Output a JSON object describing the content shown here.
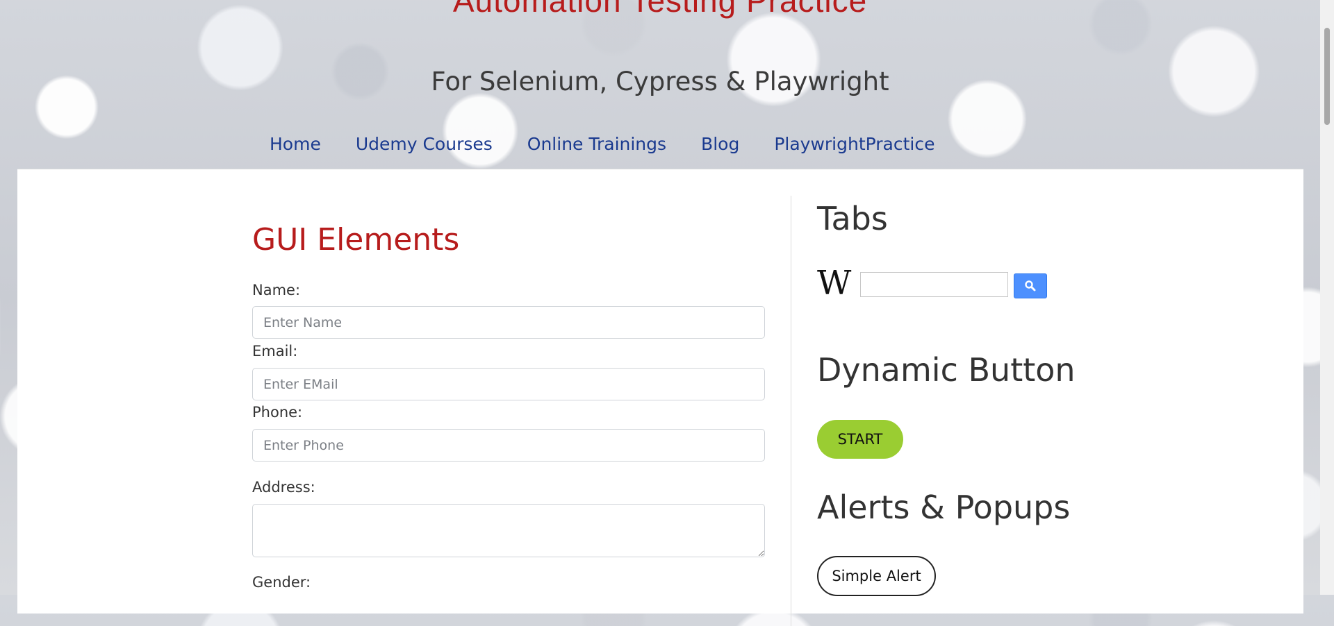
{
  "header": {
    "title": "Automation Testing Practice",
    "subtitle": "For Selenium, Cypress & Playwright",
    "nav": [
      "Home",
      "Udemy Courses",
      "Online Trainings",
      "Blog",
      "PlaywrightPractice"
    ]
  },
  "gui": {
    "title": "GUI Elements",
    "name_label": "Name:",
    "name_placeholder": "Enter Name",
    "email_label": "Email:",
    "email_placeholder": "Enter EMail",
    "phone_label": "Phone:",
    "phone_placeholder": "Enter Phone",
    "address_label": "Address:",
    "gender_label": "Gender:"
  },
  "sidebar": {
    "tabs_title": "Tabs",
    "wiki_logo": "W",
    "dynamic_title": "Dynamic Button",
    "start_label": "START",
    "alerts_title": "Alerts & Popups",
    "simple_alert_label": "Simple Alert"
  },
  "colors": {
    "title_red": "#b71c1c",
    "nav_blue": "#1a3a8f",
    "start_green": "#9acd32",
    "search_blue": "#4d90fe"
  }
}
